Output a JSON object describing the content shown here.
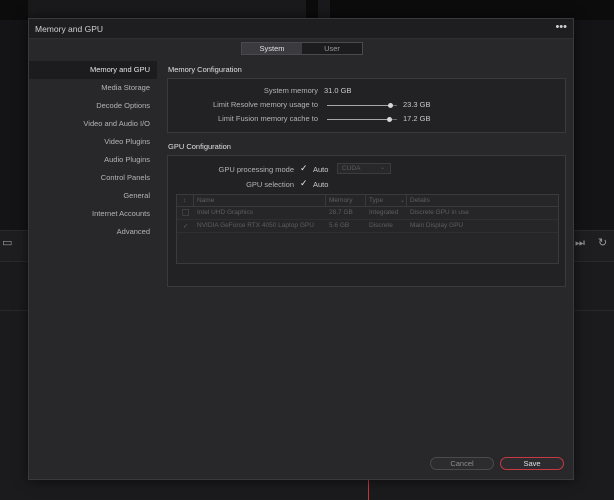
{
  "dialog": {
    "title": "Memory and GPU",
    "more_icon": "more-horizontal-icon"
  },
  "tabs": [
    {
      "label": "System",
      "active": true
    },
    {
      "label": "User",
      "active": false
    }
  ],
  "sidebar": {
    "items": [
      {
        "label": "Memory and GPU",
        "active": true
      },
      {
        "label": "Media Storage"
      },
      {
        "label": "Decode Options"
      },
      {
        "label": "Video and Audio I/O"
      },
      {
        "label": "Video Plugins"
      },
      {
        "label": "Audio Plugins"
      },
      {
        "label": "Control Panels"
      },
      {
        "label": "General"
      },
      {
        "label": "Internet Accounts"
      },
      {
        "label": "Advanced"
      }
    ]
  },
  "memory": {
    "section_title": "Memory Configuration",
    "system_memory_label": "System memory",
    "system_memory_value": "31.0 GB",
    "resolve_limit_label": "Limit Resolve memory usage to",
    "resolve_limit_value": "23.3 GB",
    "resolve_limit_fraction": 0.9,
    "fusion_limit_label": "Limit Fusion memory cache to",
    "fusion_limit_value": "17.2 GB",
    "fusion_limit_fraction": 0.88
  },
  "gpu": {
    "section_title": "GPU Configuration",
    "processing_mode_label": "GPU processing mode",
    "processing_mode_auto": "Auto",
    "processing_mode_auto_checked": true,
    "processing_mode_select": "CUDA",
    "selection_label": "GPU selection",
    "selection_auto": "Auto",
    "selection_auto_checked": true,
    "table": {
      "columns": [
        "↕",
        "Name",
        "Memory",
        "Type",
        "Details"
      ],
      "rows": [
        {
          "check": "",
          "name": "Intel UHD Graphics",
          "memory": "28.7 GB",
          "type": "Integrated",
          "details": "Discrete GPU in use"
        },
        {
          "check": "✓",
          "name": "NVIDIA GeForce RTX 4050 Laptop GPU",
          "memory": "5.6 GB",
          "type": "Discrete",
          "details": "Main Display GPU"
        }
      ]
    }
  },
  "buttons": {
    "cancel": "Cancel",
    "save": "Save"
  },
  "colors": {
    "accent": "#c63a44",
    "panel": "#28282b",
    "background": "#141416"
  }
}
